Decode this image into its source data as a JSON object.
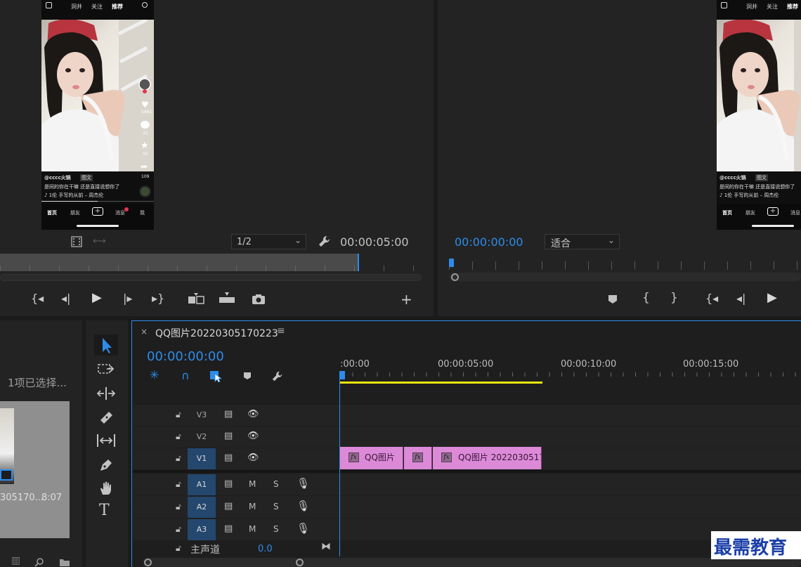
{
  "program_monitor_left": {
    "page_indicator": "1/2",
    "timecode": "00:00:05:00"
  },
  "program_monitor_right": {
    "timecode": "00:00:00:00",
    "fit_select": "适合"
  },
  "phone_preview": {
    "top_tabs": [
      "洞井",
      "关注",
      "推荐"
    ],
    "likes": "1491",
    "comments": "32",
    "favorites": "50",
    "shares": "109",
    "username": "@cccc火锅",
    "tag": "图文",
    "caption": "是同的你在干嘛 还是直接说想你了",
    "music": "♪ 1伦  手写的从前 – 周杰伦",
    "nav": [
      "首页",
      "朋友",
      "+",
      "消息",
      "我"
    ]
  },
  "project_panel": {
    "selection_status": "1项已选择...",
    "clip_name": "305170...",
    "clip_duration": "8:07"
  },
  "timeline": {
    "sequence_name": "QQ图片20220305170223",
    "playhead_timecode": "00:00:00:00",
    "ruler_labels": [
      ":00:00",
      "00:00:05:00",
      "00:00:10:00",
      "00:00:15:00"
    ],
    "video_tracks": [
      "V3",
      "V2",
      "V1"
    ],
    "audio_tracks": [
      "A1",
      "A2",
      "A3"
    ],
    "mute_label": "M",
    "solo_label": "S",
    "master_label": "主声道",
    "master_value": "0.0",
    "clips": [
      {
        "name": "QQ图片",
        "fx": "fx"
      },
      {
        "name": "",
        "fx": "fx"
      },
      {
        "name": "QQ图片 20220305170",
        "fx": "fx"
      }
    ]
  },
  "watermark": "最需教育"
}
